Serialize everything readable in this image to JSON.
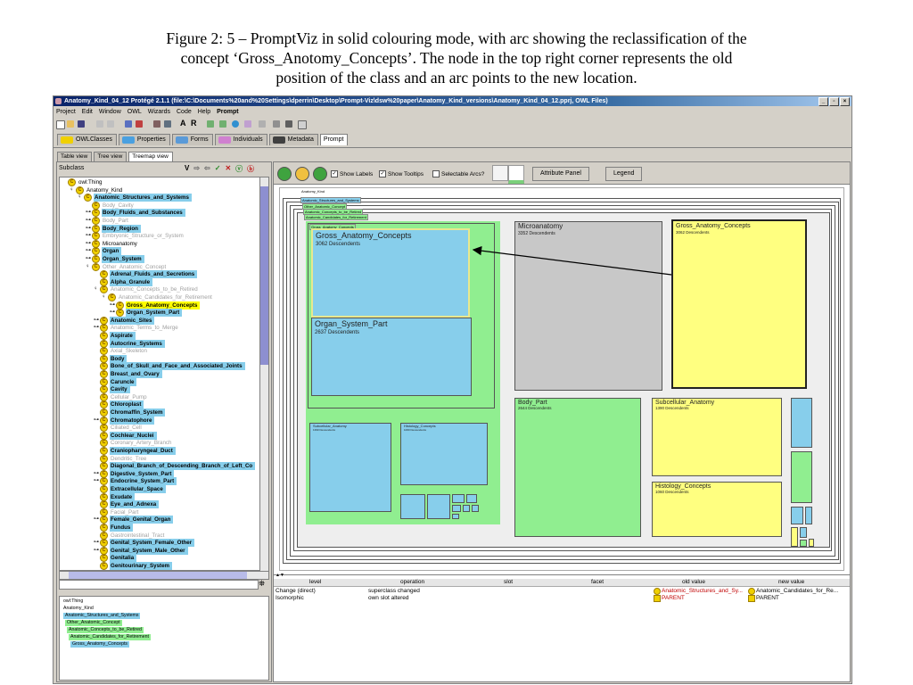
{
  "caption": {
    "line1": "Figure 2: 5 – PromptViz in solid colouring mode, with arc showing the reclassification of the",
    "line2": "concept ‘Gross_Anotomy_Concepts’.  The node in the top right corner represents the old",
    "line3": "position of the class and an arc points to the new location."
  },
  "window": {
    "title": "Anatomy_Kind_04_12  Protégé 2.1.1    (file:\\C:\\Documents%20and%20Settings\\dperrin\\Desktop\\Prompt-Viz\\dsw%20paper\\Anatomy_Kind_versions\\Anatomy_Kind_04_12.pprj, OWL Files)",
    "controls": [
      "_",
      "▫",
      "×"
    ]
  },
  "menu": [
    "Project",
    "Edit",
    "Window",
    "OWL",
    "Wizards",
    "Code",
    "Help",
    "Prompt"
  ],
  "toolbar_text": [
    "A",
    "R"
  ],
  "main_tabs": [
    {
      "label": "OWLClasses",
      "color": "#f0d000"
    },
    {
      "label": "Properties",
      "color": "#4aa0e0"
    },
    {
      "label": "Forms",
      "color": "#5a9ad8"
    },
    {
      "label": "Individuals",
      "color": "#d080d0"
    },
    {
      "label": "Metadata",
      "color": "#404040"
    },
    {
      "label": "Prompt",
      "color": ""
    }
  ],
  "view_tabs": [
    "Table view",
    "Tree view",
    "Treemap view"
  ],
  "left": {
    "header": "Subclass",
    "header_icons": [
      "V",
      "⇨",
      "⇦",
      "✓",
      "✕",
      "ⓥ",
      "ⓑ"
    ],
    "tree": [
      {
        "text": "owl:Thing",
        "style": "p",
        "indent": 0,
        "exp": ""
      },
      {
        "text": "Anatomy_Kind",
        "style": "p",
        "indent": 1,
        "exp": "♀"
      },
      {
        "text": "Anatomic_Structures_and_Systems",
        "style": "b",
        "indent": 2,
        "exp": "♀"
      },
      {
        "text": "Body_Cavity",
        "style": "g",
        "indent": 3,
        "exp": ""
      },
      {
        "text": "Body_Fluids_and_Substances",
        "style": "b",
        "indent": 3,
        "exp": "⊶"
      },
      {
        "text": "Body_Part",
        "style": "g",
        "indent": 3,
        "exp": "⊶"
      },
      {
        "text": "Body_Region",
        "style": "b",
        "indent": 3,
        "exp": "⊶"
      },
      {
        "text": "Embryonic_Structure_or_System",
        "style": "g",
        "indent": 3,
        "exp": "⊶"
      },
      {
        "text": "Microanatomy",
        "style": "p",
        "indent": 3,
        "exp": "⊶"
      },
      {
        "text": "Organ",
        "style": "b",
        "indent": 3,
        "exp": "⊶"
      },
      {
        "text": "Organ_System",
        "style": "b",
        "indent": 3,
        "exp": "⊶"
      },
      {
        "text": "Other_Anatomic_Concept",
        "style": "g",
        "indent": 3,
        "exp": "♀"
      },
      {
        "text": "Adrenal_Fluids_and_Secretions",
        "style": "b",
        "indent": 4,
        "exp": ""
      },
      {
        "text": "Alpha_Granule",
        "style": "b",
        "indent": 4,
        "exp": ""
      },
      {
        "text": "Anatomic_Concepts_to_be_Retired",
        "style": "g",
        "indent": 4,
        "exp": "♀"
      },
      {
        "text": "Anatomic_Candidates_for_Retirement",
        "style": "g",
        "indent": 5,
        "exp": "♀"
      },
      {
        "text": "Gross_Anatomy_Concepts",
        "style": "s",
        "indent": 6,
        "exp": "⊶"
      },
      {
        "text": "Organ_System_Part",
        "style": "b",
        "indent": 6,
        "exp": "⊶"
      },
      {
        "text": "Anatomic_Sites",
        "style": "b",
        "indent": 4,
        "exp": "⊶"
      },
      {
        "text": "Anatomic_Terms_to_Merge",
        "style": "g",
        "indent": 4,
        "exp": "⊶"
      },
      {
        "text": "Aspirate",
        "style": "b",
        "indent": 4,
        "exp": ""
      },
      {
        "text": "Autocrine_Systems",
        "style": "b",
        "indent": 4,
        "exp": ""
      },
      {
        "text": "Axial_Skeleton",
        "style": "g",
        "indent": 4,
        "exp": ""
      },
      {
        "text": "Body",
        "style": "b",
        "indent": 4,
        "exp": ""
      },
      {
        "text": "Bone_of_Skull_and_Face_and_Associated_Joints",
        "style": "b",
        "indent": 4,
        "exp": ""
      },
      {
        "text": "Breast_and_Ovary",
        "style": "b",
        "indent": 4,
        "exp": ""
      },
      {
        "text": "Caruncle",
        "style": "b",
        "indent": 4,
        "exp": ""
      },
      {
        "text": "Cavity",
        "style": "b",
        "indent": 4,
        "exp": ""
      },
      {
        "text": "Cellular_Pump",
        "style": "g",
        "indent": 4,
        "exp": ""
      },
      {
        "text": "Chloroplast",
        "style": "b",
        "indent": 4,
        "exp": ""
      },
      {
        "text": "Chromaffin_System",
        "style": "b",
        "indent": 4,
        "exp": ""
      },
      {
        "text": "Chromatophore",
        "style": "b",
        "indent": 4,
        "exp": "⊶"
      },
      {
        "text": "Ciliated_Cell",
        "style": "g",
        "indent": 4,
        "exp": ""
      },
      {
        "text": "Cochlear_Nuclei",
        "style": "b",
        "indent": 4,
        "exp": ""
      },
      {
        "text": "Coronary_Artery_Branch",
        "style": "g",
        "indent": 4,
        "exp": ""
      },
      {
        "text": "Craniopharyngeal_Duct",
        "style": "b",
        "indent": 4,
        "exp": ""
      },
      {
        "text": "Dendritic_Tree",
        "style": "g",
        "indent": 4,
        "exp": ""
      },
      {
        "text": "Diagonal_Branch_of_Descending_Branch_of_Left_Co",
        "style": "b",
        "indent": 4,
        "exp": ""
      },
      {
        "text": "Digestive_System_Part",
        "style": "b",
        "indent": 4,
        "exp": "⊶"
      },
      {
        "text": "Endocrine_System_Part",
        "style": "b",
        "indent": 4,
        "exp": "⊶"
      },
      {
        "text": "Extracellular_Space",
        "style": "b",
        "indent": 4,
        "exp": ""
      },
      {
        "text": "Exudate",
        "style": "b",
        "indent": 4,
        "exp": ""
      },
      {
        "text": "Eye_and_Adnexa",
        "style": "b",
        "indent": 4,
        "exp": ""
      },
      {
        "text": "Facial_Part",
        "style": "g",
        "indent": 4,
        "exp": ""
      },
      {
        "text": "Female_Genital_Organ",
        "style": "b",
        "indent": 4,
        "exp": "⊶"
      },
      {
        "text": "Fundus",
        "style": "b",
        "indent": 4,
        "exp": ""
      },
      {
        "text": "Gastrointestinal_Tract",
        "style": "g",
        "indent": 4,
        "exp": ""
      },
      {
        "text": "Genital_System_Female_Other",
        "style": "b",
        "indent": 4,
        "exp": "⊶"
      },
      {
        "text": "Genital_System_Male_Other",
        "style": "b",
        "indent": 4,
        "exp": "⊶"
      },
      {
        "text": "Genitalia",
        "style": "b",
        "indent": 4,
        "exp": ""
      },
      {
        "text": "Genitourinary_System",
        "style": "b",
        "indent": 4,
        "exp": ""
      }
    ],
    "path_tree": [
      {
        "text": "owl:Thing",
        "bg": ""
      },
      {
        "text": "Anatomy_Kind",
        "bg": ""
      },
      {
        "text": "Anatomic_Structures_and_Systems",
        "bg": "#87ceeb"
      },
      {
        "text": "Other_Anatomic_Concept",
        "bg": "#90ee90"
      },
      {
        "text": "Anatomic_Concepts_to_be_Retired",
        "bg": "#90ee90"
      },
      {
        "text": "Anatomic_Candidates_for_Retirement",
        "bg": "#90ee90"
      },
      {
        "text": "Gross_Anatomy_Concepts",
        "bg": "#87ceeb"
      }
    ]
  },
  "right": {
    "checks": [
      {
        "label": "Show Labels",
        "checked": true
      },
      {
        "label": "Show Tooltips",
        "checked": true
      },
      {
        "label": "Selectable Arcs?",
        "checked": false
      }
    ],
    "buttons": [
      "Attribute Panel",
      "Legend"
    ],
    "crumbs": [
      "Anatomy_Kind",
      "Anatomic_Structures_and_Systems",
      "Other_Anatomic_Concept",
      "Anatomic_Concepts_to_be_Retired",
      "Anatomic_Candidates_for_Retirement"
    ],
    "inner_crumb": "Gross_Anatomy_Concepts",
    "boxes": {
      "gross": {
        "name": "Gross_Anatomy_Concepts",
        "desc": "3062 Descendents"
      },
      "organ": {
        "name": "Organ_System_Part",
        "desc": "2637 Descendents"
      },
      "micro": {
        "name": "Microanatomy",
        "desc": "3352 Descendents"
      },
      "gross_old": {
        "name": "Gross_Anatomy_Concepts",
        "desc": "3062 Descendents"
      },
      "body": {
        "name": "Body_Part",
        "desc": "2644 Descendents"
      },
      "subcell": {
        "name": "Subcellular_Anatomy",
        "desc": "1390 Descendents"
      },
      "histo": {
        "name": "Histology_Concepts",
        "desc": "1060 Descendents"
      },
      "subcell_small": {
        "name": "Subcellular_Anatomy",
        "desc": "1390 Descendents"
      },
      "histo_small": {
        "name": "Histology_Concepts",
        "desc": "1060 Descendents"
      }
    },
    "table": {
      "headers": [
        "level",
        "operation",
        "slot",
        "facet",
        "old value",
        "new value"
      ],
      "rows": [
        {
          "level": "Change (direct)",
          "operation": "superclass changed",
          "old": "Anatomic_Structures_and_Sy...",
          "new": "Anatomic_Candidates_for_Re..."
        },
        {
          "level": "Isomorphic",
          "operation": "own slot altered",
          "old": "PARENT",
          "new": "PARENT"
        }
      ]
    }
  },
  "colors": {
    "blue": "#87ceeb",
    "green": "#90ee90",
    "yellow": "#ffff80",
    "grey": "#c8c8c8",
    "selected": "#ffff00"
  }
}
